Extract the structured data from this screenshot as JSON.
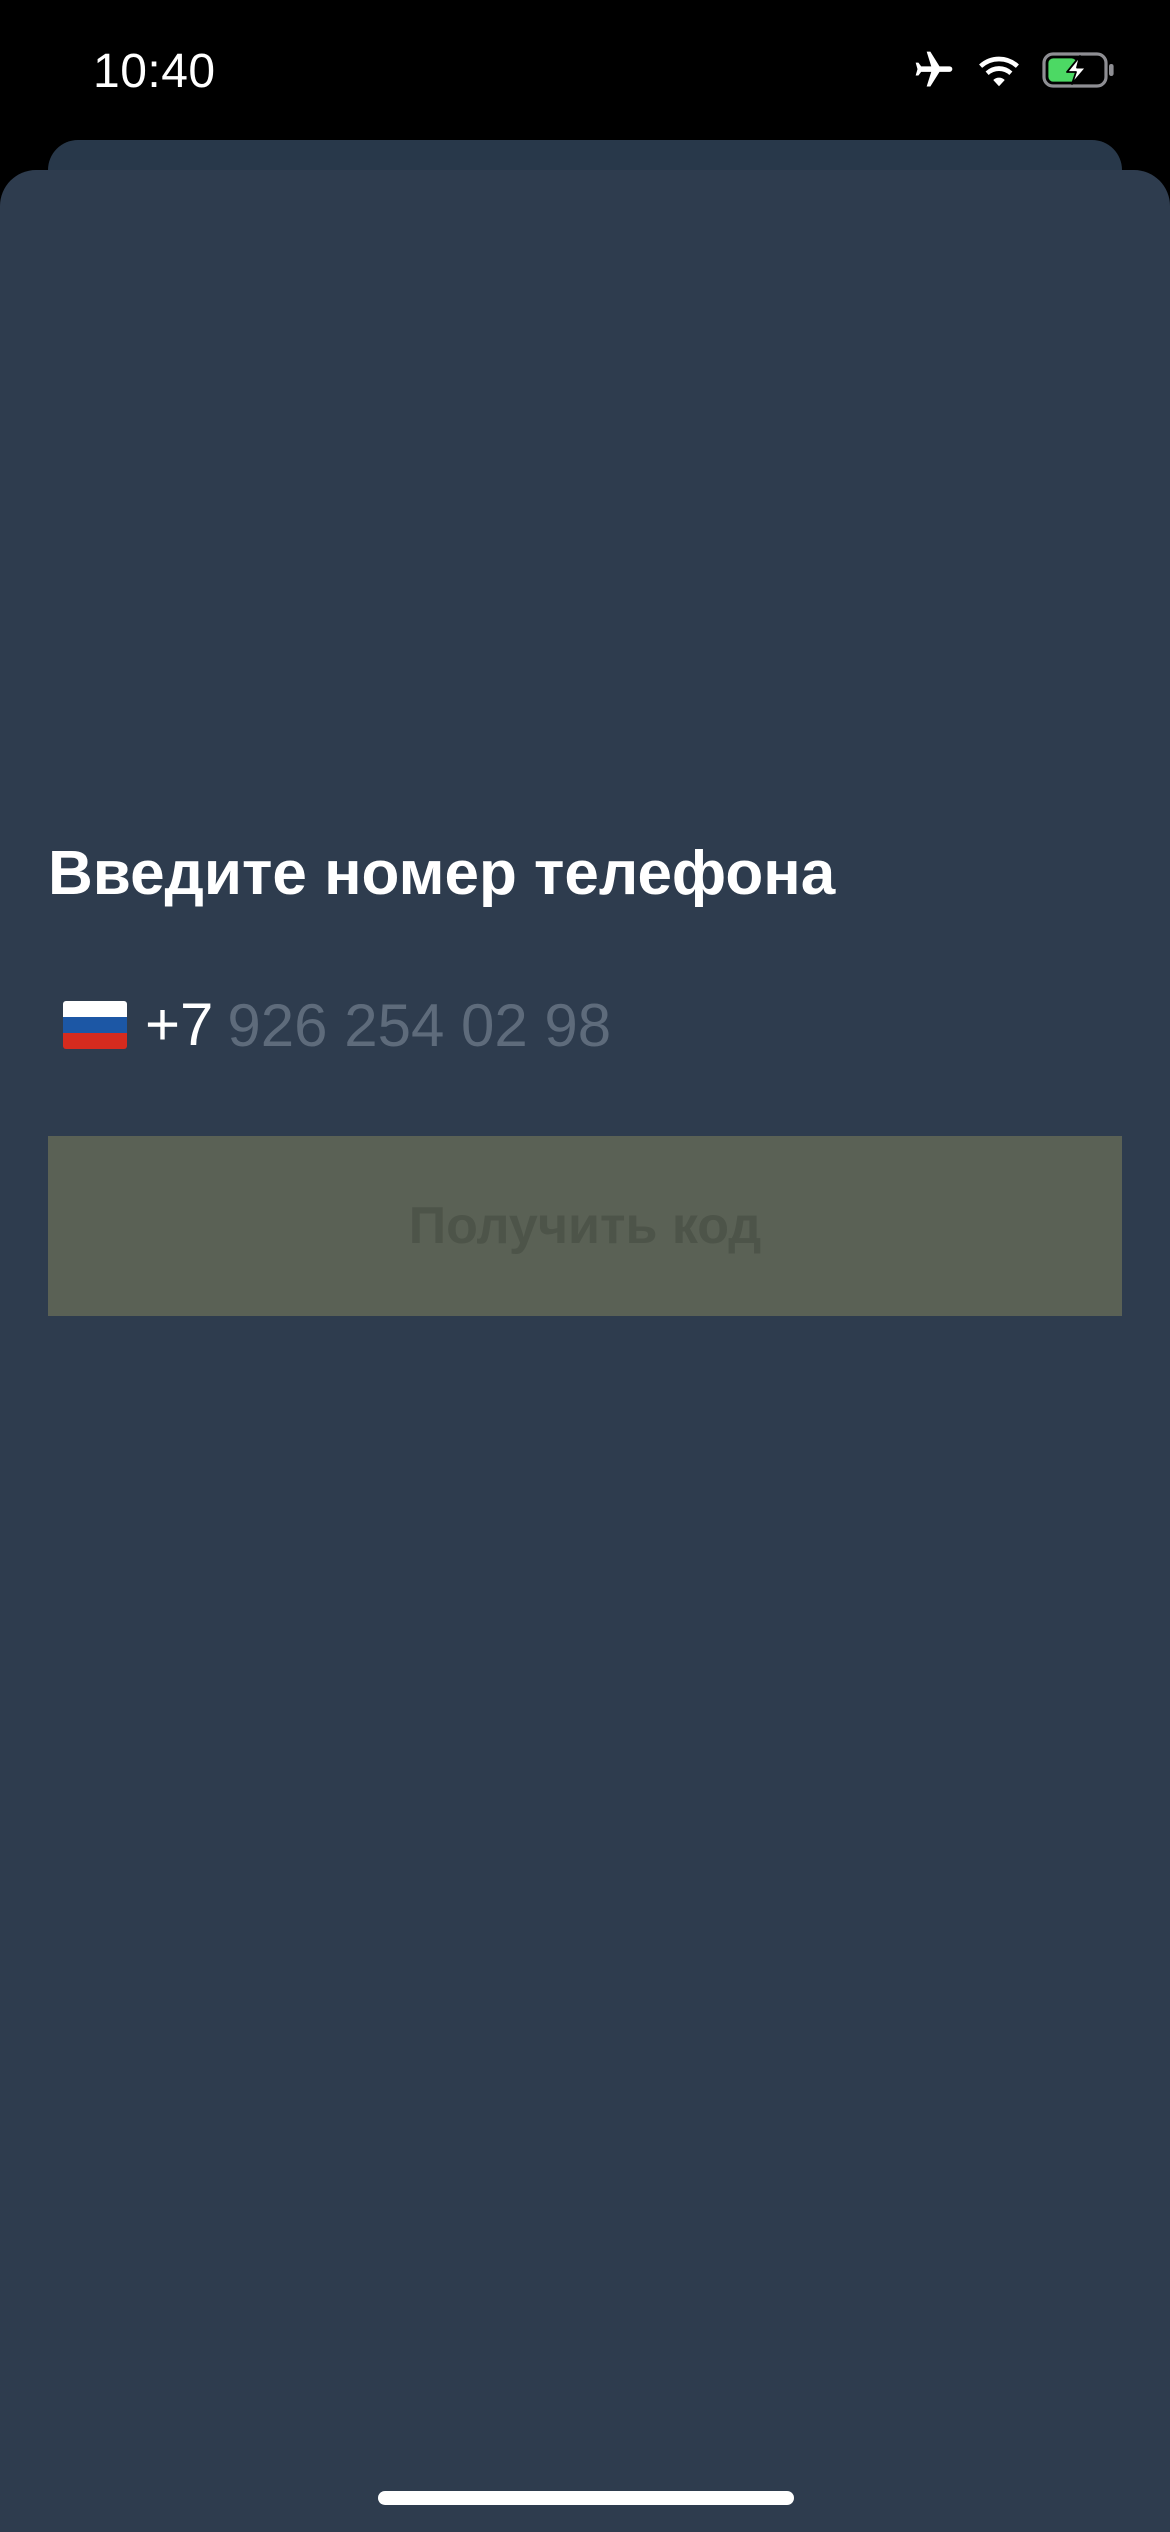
{
  "status_bar": {
    "time": "10:40",
    "icons": [
      "airplane-icon",
      "wifi-icon",
      "battery-charging-icon"
    ],
    "battery_color": "#4cd964"
  },
  "screen": {
    "title": "Введите номер телефона",
    "country": {
      "flag": "russia-flag-icon",
      "flag_colors": [
        "#ffffff",
        "#1c57a5",
        "#d52b1e"
      ],
      "code": "+7"
    },
    "phone": {
      "value": "",
      "placeholder": "926 254 02 98"
    },
    "submit_label": "Получить код"
  },
  "colors": {
    "sheet_background": "#2e3c4e",
    "button_disabled_background": "#5a6155",
    "button_disabled_text": "#4d5449",
    "placeholder_text": "#5e6b7b"
  }
}
